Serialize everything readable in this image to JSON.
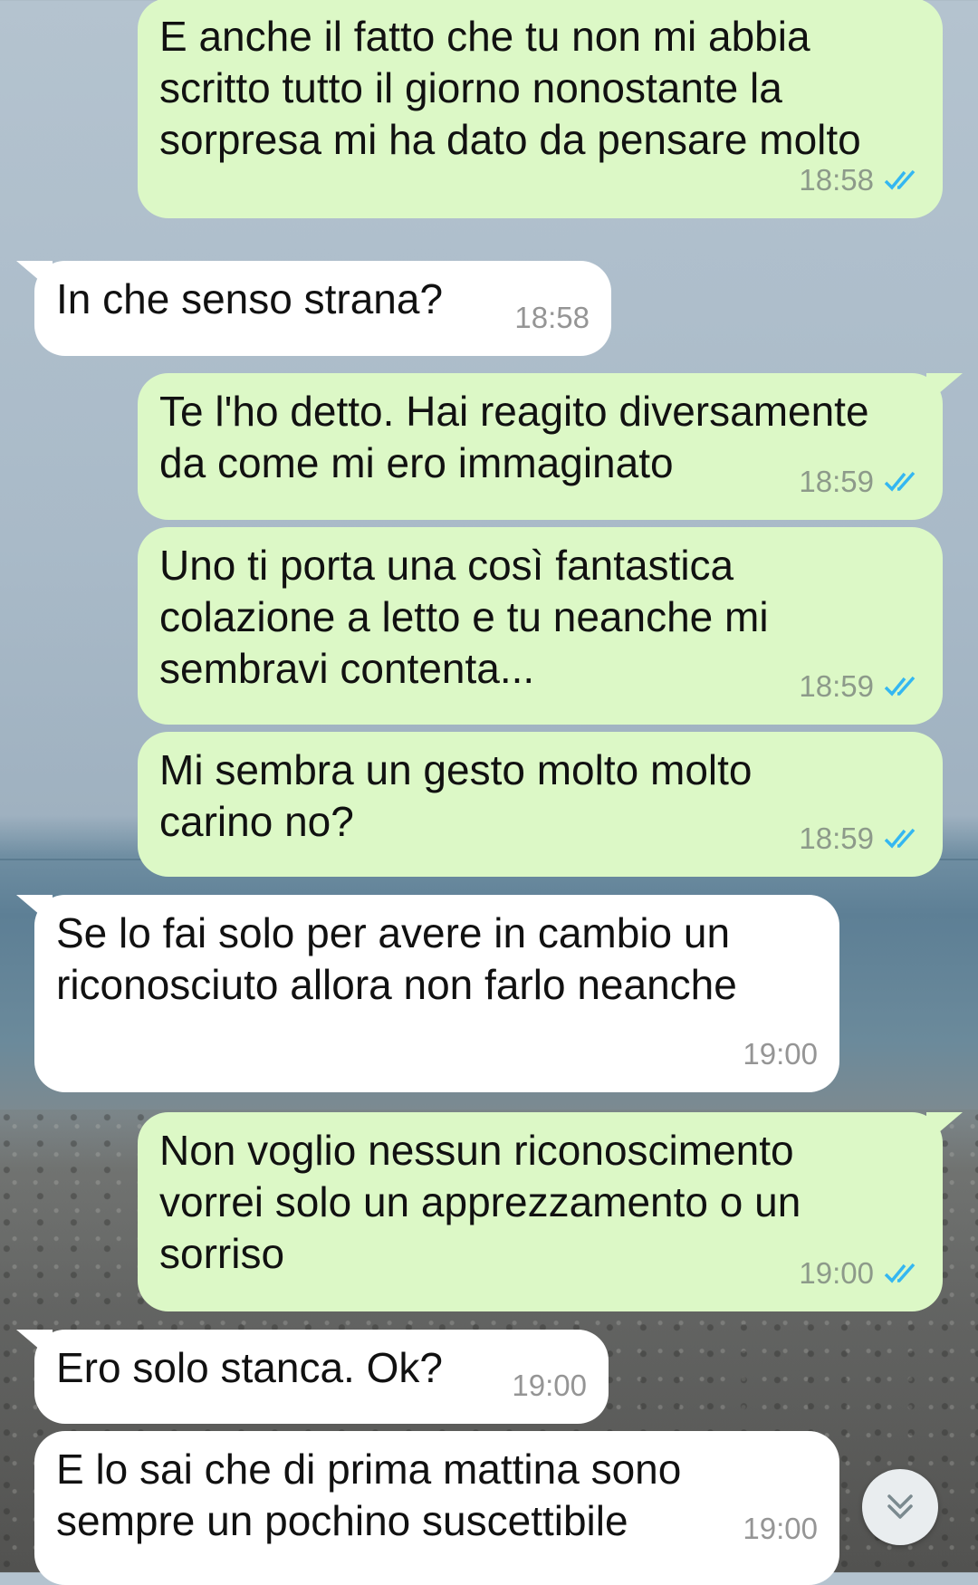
{
  "wallpaper": {
    "sky": "#b4c3cf",
    "sea": "#5d7f95",
    "shore": "#5f5f5d"
  },
  "colors": {
    "outgoing_bubble": "#dcf8c6",
    "incoming_bubble": "#ffffff",
    "read_ticks": "#34b7f1"
  },
  "messages": [
    {
      "dir": "out",
      "text": "E anche il fatto che tu non mi abbia\nscritto tutto il giorno nonostante la\nsorpresa mi ha dato da pensare molto",
      "time": "18:58",
      "status": "read"
    },
    {
      "dir": "in",
      "text": "In che senso strana?",
      "time": "18:58"
    },
    {
      "dir": "out",
      "text": "Te l'ho detto. Hai reagito diversamente\nda come mi ero immaginato",
      "time": "18:59",
      "status": "read"
    },
    {
      "dir": "out",
      "text": "Uno ti porta una così fantastica\ncolazione a letto e tu neanche mi\nsembravi contenta...",
      "time": "18:59",
      "status": "read"
    },
    {
      "dir": "out",
      "text": "Mi sembra un gesto molto molto\ncarino no?",
      "time": "18:59",
      "status": "read"
    },
    {
      "dir": "in",
      "text": "Se lo fai solo per avere in cambio un\nriconosciuto allora non farlo neanche",
      "time": "19:00"
    },
    {
      "dir": "out",
      "text": "Non voglio nessun riconoscimento\nvorrei solo un apprezzamento o un\nsorriso",
      "time": "19:00",
      "status": "read"
    },
    {
      "dir": "in",
      "text": "Ero solo stanca. Ok?",
      "time": "19:00"
    },
    {
      "dir": "in",
      "text": "E lo sai che di prima mattina sono\nsempre un pochino suscettibile",
      "time": "19:00"
    }
  ],
  "scroll_button": {
    "icon": "double-chevron-down-icon"
  }
}
